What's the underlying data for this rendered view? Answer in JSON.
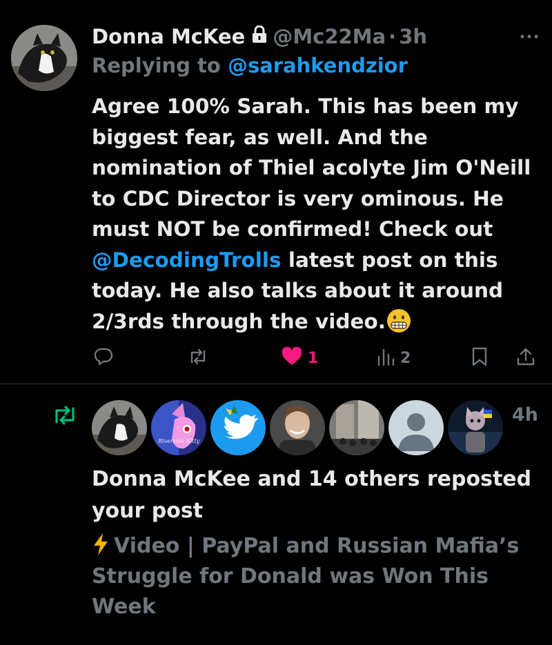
{
  "tweet": {
    "author_name": "Donna McKee",
    "handle": "@Mc22Ma",
    "separator": "·",
    "time": "3h",
    "replying_prefix": "Replying to ",
    "replying_to": "@sarahkendzior",
    "body_part1": "Agree 100% Sarah. This has been my biggest fear, as well. And the nomination of Thiel acolyte Jim O'Neill to CDC Director is very ominous. He must NOT be confirmed! Check out ",
    "body_mention": "@DecodingTrolls",
    "body_part2": " latest post on this today. He also talks about it around 2/3rds through the video.",
    "emoji": "grimacing-face",
    "actions": {
      "like_count": "1",
      "views_count": "2"
    }
  },
  "notification": {
    "time": "4h",
    "text": "Donna McKee and 14 others reposted your post",
    "post_preview": "Video | PayPal and Russian Mafia’s Struggle for Donald was Won This Week",
    "preview_prefix_icon": "lightning-bolt",
    "avatar_text": "Riverside Kitty",
    "avatar_count": 7
  },
  "colors": {
    "background": "#000000",
    "text": "#e7e9ea",
    "muted": "#71767b",
    "link": "#1d9bf0",
    "like": "#f91880",
    "repost": "#00ba7c",
    "divider": "#2f3336"
  }
}
